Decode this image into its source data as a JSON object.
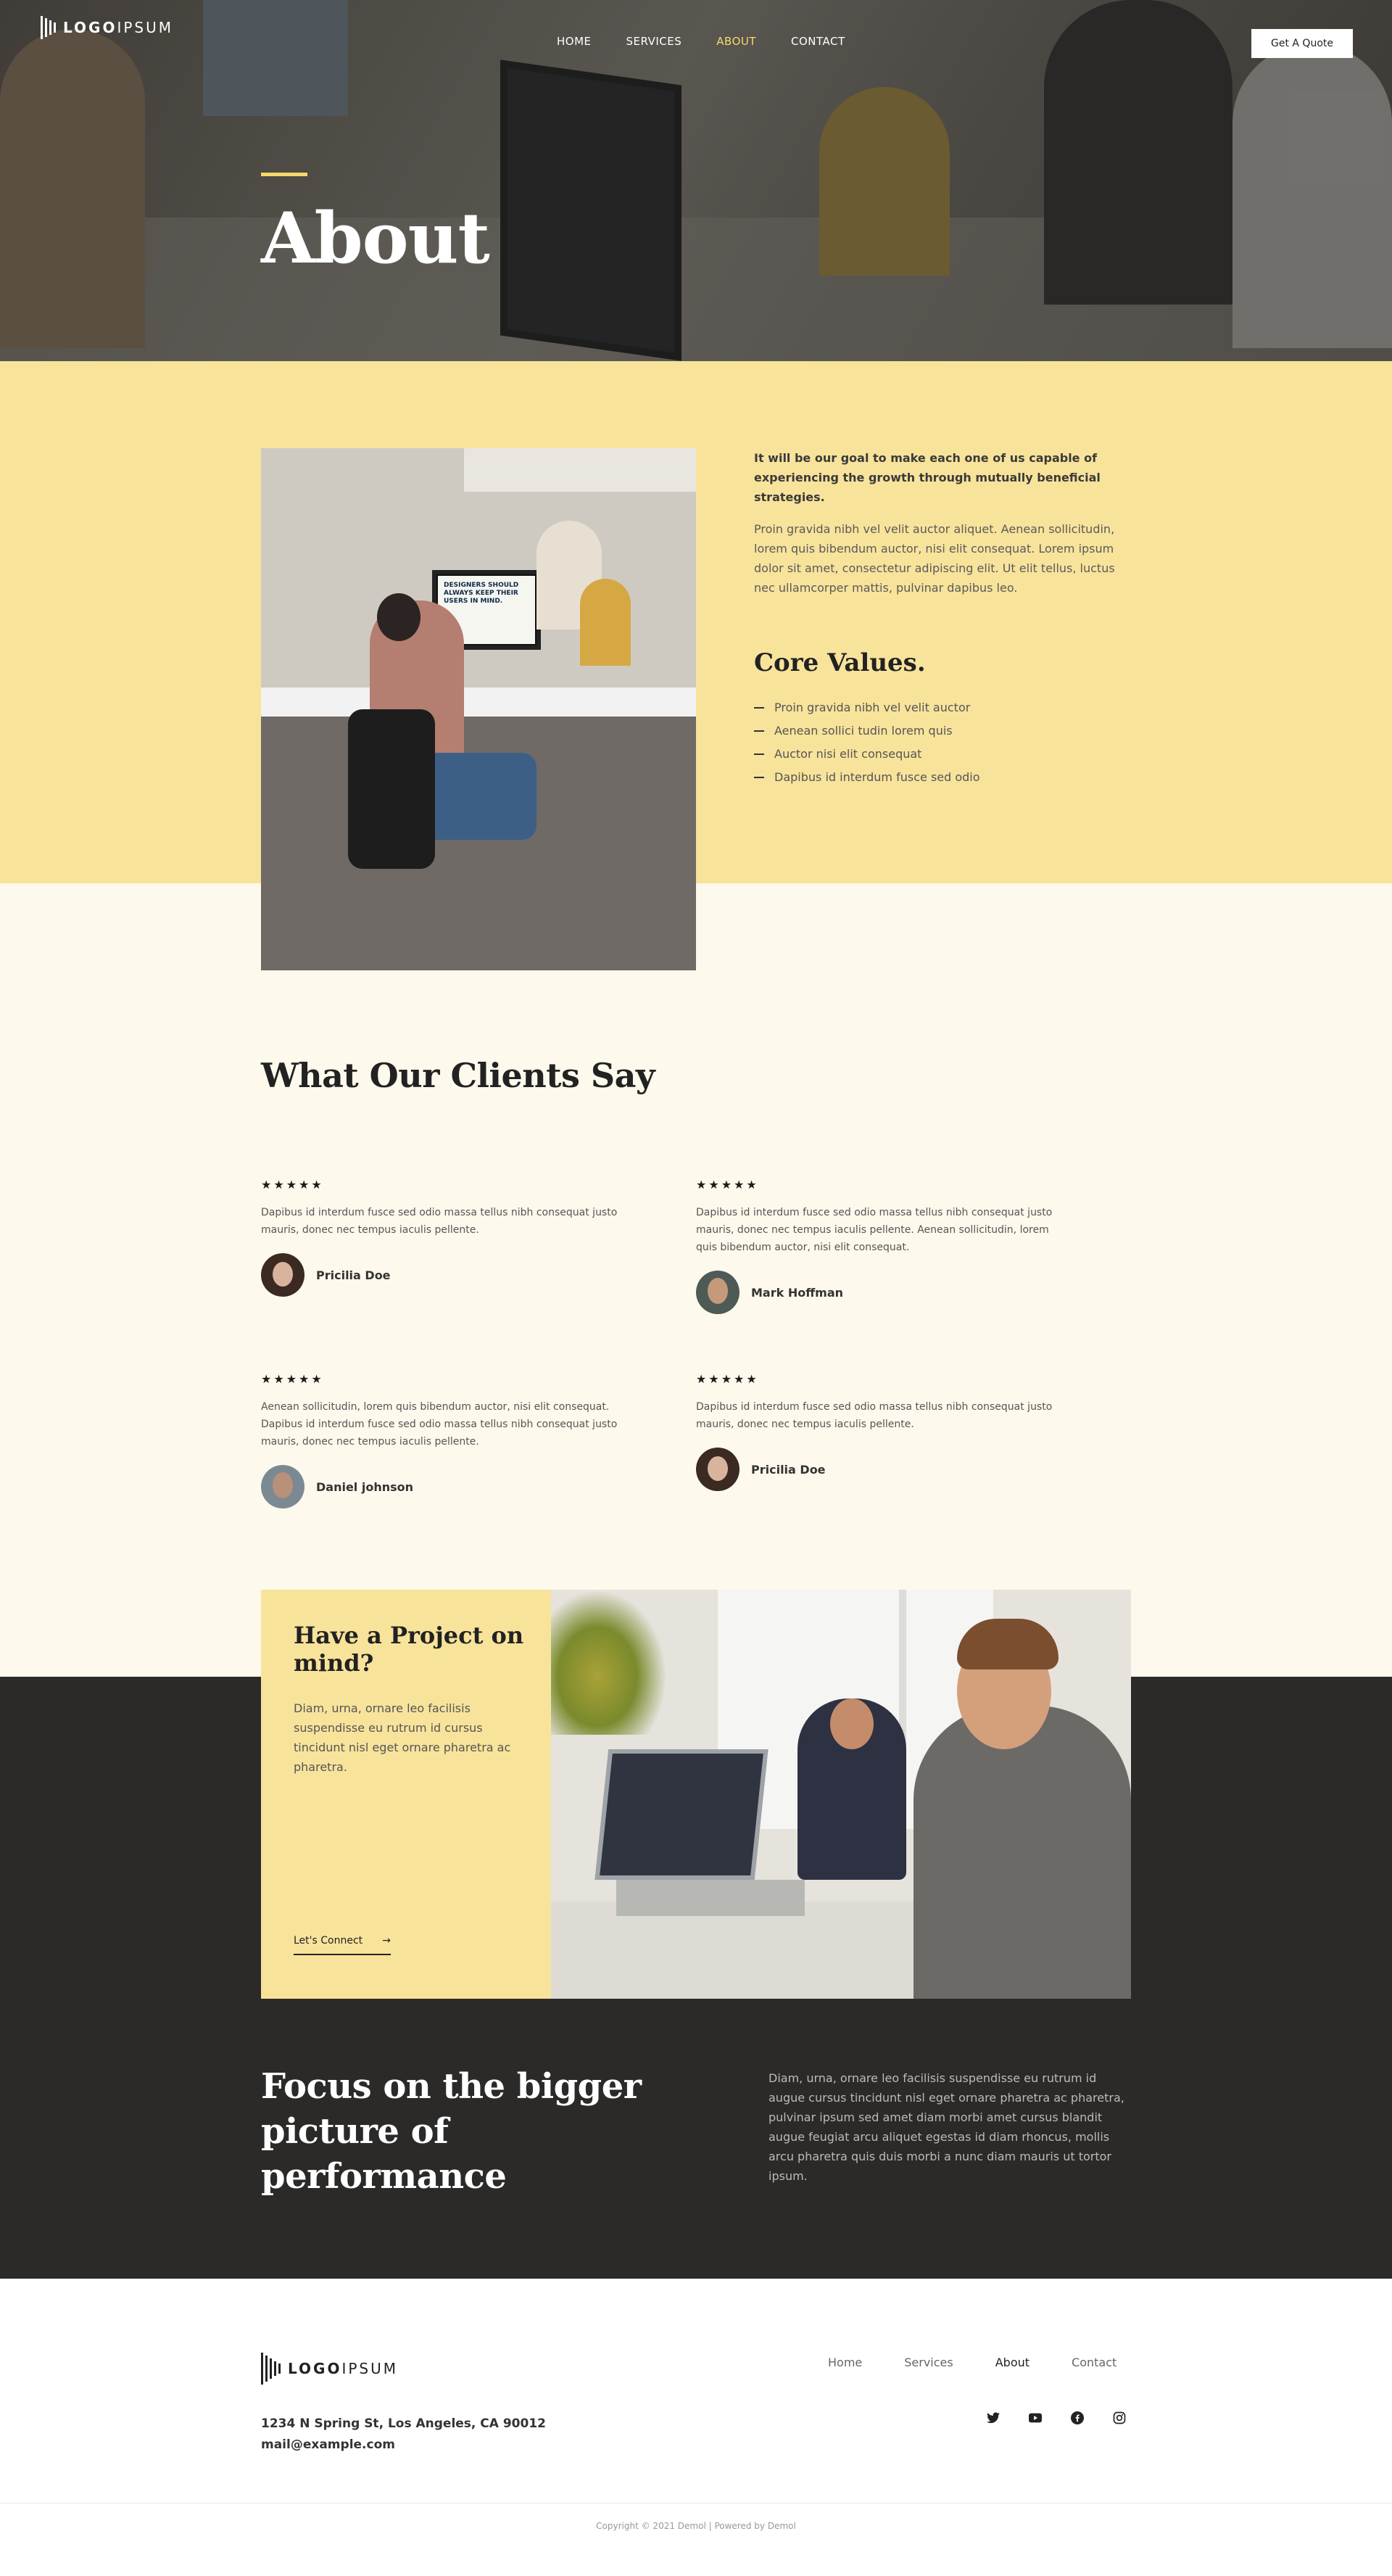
{
  "colors": {
    "accent": "#f8e39b",
    "accent_bright": "#f5d96b",
    "dark": "#2b2a29",
    "cream": "#fdf9ec"
  },
  "header": {
    "logo": {
      "bold": "LOGO",
      "light": "IPSUM"
    },
    "nav": [
      {
        "label": "HOME"
      },
      {
        "label": "SERVICES"
      },
      {
        "label": "ABOUT",
        "active": true
      },
      {
        "label": "CONTACT"
      }
    ],
    "cta_label": "Get A Quote"
  },
  "hero": {
    "title": "About"
  },
  "about": {
    "lead": "It will be our goal to make each one of us capable of experiencing the growth through mutually beneficial strategies.",
    "body": "Proin gravida nibh vel velit auctor aliquet. Aenean sollicitudin, lorem quis bibendum auctor, nisi elit consequat. Lorem ipsum dolor sit amet, consectetur adipiscing elit. Ut elit tellus, luctus nec ullamcorper mattis, pulvinar dapibus leo.",
    "photo_caption": "DESIGNERS SHOULD ALWAYS KEEP THEIR USERS IN MIND.",
    "core_title": "Core Values.",
    "core_values": [
      "Proin gravida nibh vel velit auctor",
      "Aenean sollici tudin lorem quis",
      "Auctor nisi elit consequat",
      "Dapibus id interdum fusce sed odio"
    ]
  },
  "testimonials": {
    "title": "What Our Clients Say",
    "items": [
      {
        "stars": "★★★★★",
        "rating": 4.5,
        "quote": "Dapibus id interdum fusce sed odio massa tellus nibh consequat justo mauris, donec nec tempus iaculis pellente.",
        "name": "Pricilia Doe"
      },
      {
        "stars": "★★★★★",
        "rating": 4.5,
        "quote": "Dapibus id interdum fusce sed odio massa tellus nibh consequat justo mauris, donec nec tempus iaculis pellente. Aenean sollicitudin, lorem quis bibendum auctor, nisi elit consequat.",
        "name": "Mark Hoffman"
      },
      {
        "stars": "★★★★★",
        "rating": 4.5,
        "quote": "Aenean sollicitudin, lorem quis bibendum auctor, nisi elit consequat. Dapibus id interdum fusce sed odio massa tellus nibh consequat justo mauris, donec nec tempus iaculis pellente.",
        "name": "Daniel johnson"
      },
      {
        "stars": "★★★★★",
        "rating": 4.5,
        "quote": "Dapibus id interdum fusce sed odio massa tellus nibh consequat justo mauris, donec nec tempus iaculis pellente.",
        "name": "Pricilia Doe"
      }
    ]
  },
  "project": {
    "title": "Have a Project on mind?",
    "text": "Diam, urna, ornare leo facilisis suspendisse eu rutrum id cursus tincidunt nisl eget ornare pharetra ac pharetra.",
    "link_label": "Let's Connect",
    "link_icon": "arrow-right-icon"
  },
  "focus": {
    "title": "Focus on the bigger picture of performance",
    "text": "Diam, urna, ornare leo facilisis suspendisse eu rutrum id augue cursus tincidunt nisl eget ornare pharetra ac pharetra, pulvinar ipsum sed amet diam morbi amet cursus blandit augue feugiat arcu aliquet egestas id diam rhoncus, mollis arcu pharetra quis duis morbi a nunc diam mauris ut tortor ipsum."
  },
  "footer": {
    "logo": {
      "bold": "LOGO",
      "light": "IPSUM"
    },
    "nav": [
      {
        "label": "Home"
      },
      {
        "label": "Services"
      },
      {
        "label": "About",
        "active": true
      },
      {
        "label": "Contact"
      }
    ],
    "address": "1234 N Spring St, Los Angeles, CA 90012",
    "email": "mail@example.com",
    "social": [
      "twitter-icon",
      "youtube-icon",
      "facebook-icon",
      "instagram-icon"
    ],
    "copyright": "Copyright © 2021 Demol | Powered by Demol"
  }
}
